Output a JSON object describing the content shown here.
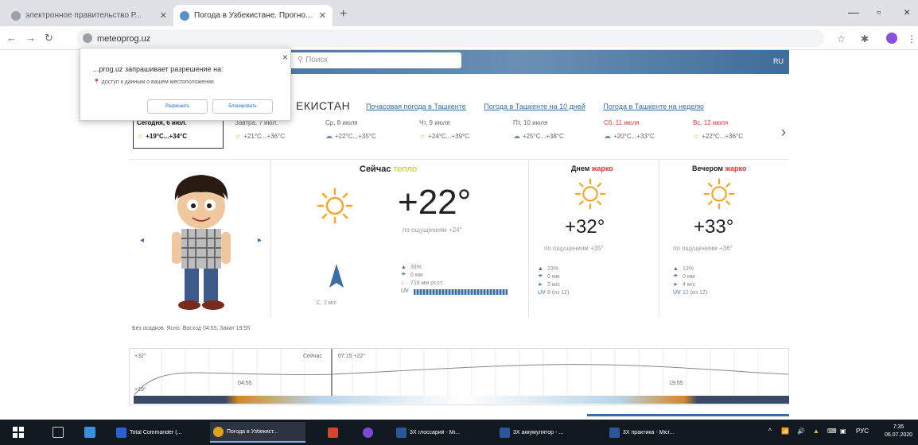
{
  "browser": {
    "tabs": [
      {
        "title": "электронное правительство Р...",
        "active": false
      },
      {
        "title": "Погода в Узбекистане. Прогноз...",
        "active": true
      }
    ],
    "new_tab": "+",
    "url": "meteoprog.uz",
    "window": {
      "minimize": "—",
      "maximize": "▫",
      "close": "×"
    }
  },
  "permission_popup": {
    "title": "...prog.uz запрашивает разрешение на:",
    "item": "доступ к данным о вашем местоположении",
    "allow": "Разрешить",
    "block": "Блокировать",
    "close": "×"
  },
  "site": {
    "search_placeholder": "Поиск",
    "lang": "RU",
    "page_title": "ЕКИСТАН",
    "links": [
      "Почасовая погода в Ташкенте",
      "Погода в Ташкенте на 10 дней",
      "Погода в Ташкенте на неделю"
    ]
  },
  "days": [
    {
      "name": "Сегодня, 6 июл.",
      "temp": "+19°C...+34°C",
      "icon": "sun",
      "selected": true
    },
    {
      "name": "Завтра, 7 июл.",
      "temp": "+21°C...+36°C",
      "icon": "sun",
      "selected": false
    },
    {
      "name": "Ср, 8 июля",
      "temp": "+22°C...+35°C",
      "icon": "cloud",
      "selected": false
    },
    {
      "name": "Чт, 9 июля",
      "temp": "+24°C...+39°C",
      "icon": "sun",
      "selected": false
    },
    {
      "name": "Пт, 10 июля",
      "temp": "+25°C...+38°C",
      "icon": "cloud",
      "selected": false
    },
    {
      "name": "Сб, 11 июля",
      "temp": "+20°C...+33°C",
      "icon": "cloud",
      "selected": false
    },
    {
      "name": "Вс, 12 июля",
      "temp": "+22°C...+36°C",
      "icon": "sun",
      "selected": false
    }
  ],
  "now": {
    "label": "Сейчас",
    "state": "тепло",
    "temp": "+22°",
    "feels": "по ощущениям +24°",
    "humidity": "33%",
    "precip": "0 мм",
    "pressure": "716 мм рт.ст.",
    "uv_label": "UV",
    "wind": "С, 2 м/с"
  },
  "day": {
    "label": "Днем",
    "state": "жарко",
    "temp": "+32°",
    "feels": "по ощущениям +35°",
    "humidity": "23%",
    "precip": "0 мм",
    "wind": "3 м/с",
    "uv": "8 (из 12)"
  },
  "evening": {
    "label": "Вечером",
    "state": "жарко",
    "temp": "+33°",
    "feels": "по ощущениям +36°",
    "humidity": "13%",
    "precip": "0 мм",
    "wind": "4 м/с",
    "uv": "12 (из 12)"
  },
  "summary": "Без осадков. Ясно. Восход 04:55, Закат 19:55",
  "hourly": {
    "temp_top": "+32°",
    "temp_low": "+19°",
    "now_label": "Сейчас",
    "now_time": "07:15 +22°",
    "sunrise": "04:55",
    "sunset": "19:55"
  },
  "taskbar": {
    "apps": [
      {
        "label": "Total Commander (...",
        "color": "#2a62c9"
      },
      {
        "label": "Погода в Узбекист...",
        "color": "#e0a11b",
        "active": true
      },
      {
        "label": "",
        "color": "#d0452b"
      },
      {
        "label": "",
        "color": "#7c4ad8"
      },
      {
        "label": "3Х глоссарий - Mi...",
        "color": "#2b579a"
      },
      {
        "label": "3Х аккумулятор - ...",
        "color": "#2b579a"
      },
      {
        "label": "3Х практика - Micr...",
        "color": "#2b579a"
      }
    ],
    "lang": "РУС",
    "time": "7:35",
    "date": "06.07.2020"
  }
}
